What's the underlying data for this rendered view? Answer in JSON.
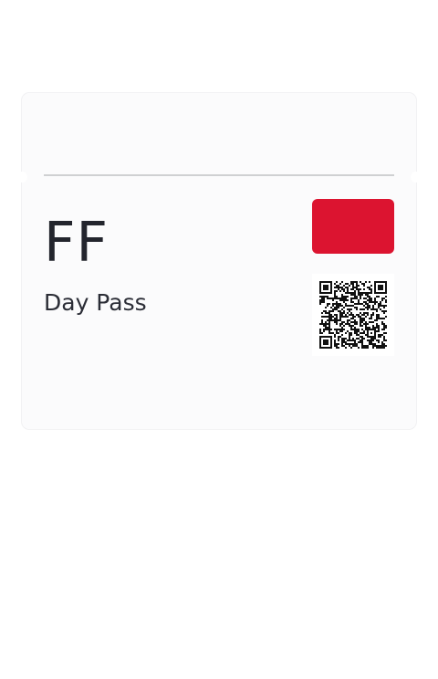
{
  "ticket": {
    "code": "FF",
    "pass_name": "Day Pass",
    "accent_color": "#dc1430",
    "qr_icon": "qr-code-icon"
  }
}
